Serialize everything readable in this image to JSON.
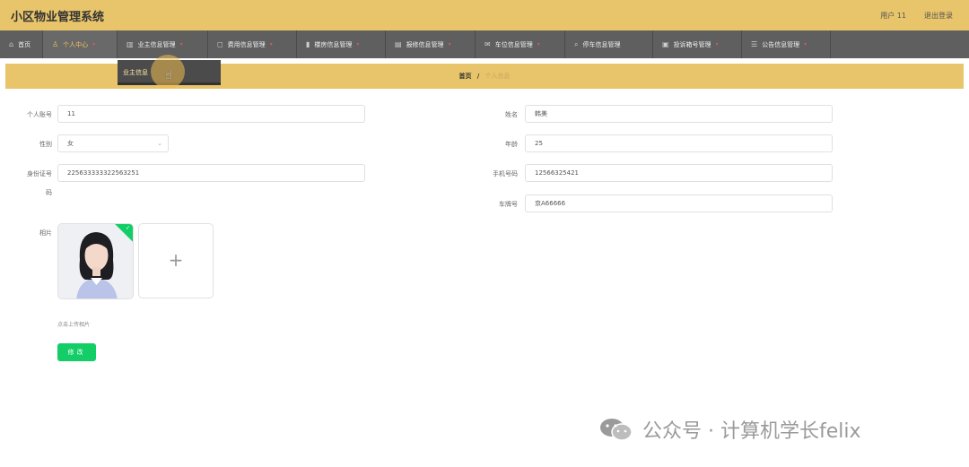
{
  "header": {
    "title": "小区物业管理系统",
    "user": "用户 11",
    "logout": "退出登录",
    "bg_color": "#e8c46a"
  },
  "nav": {
    "items": [
      {
        "label": "首页",
        "icon": "home-icon"
      },
      {
        "label": "个人中心",
        "icon": "user-icon",
        "active": true
      },
      {
        "label": "业主信息管理",
        "icon": "building-icon"
      },
      {
        "label": "费用信息管理",
        "icon": "square-icon"
      },
      {
        "label": "楼房信息管理",
        "icon": "bars-icon"
      },
      {
        "label": "报修信息管理",
        "icon": "message-icon"
      },
      {
        "label": "车位信息管理",
        "icon": "mail-icon"
      },
      {
        "label": "停车信息管理",
        "icon": "search-icon"
      },
      {
        "label": "投诉箱号管理",
        "icon": "inbox-icon"
      },
      {
        "label": "公告信息管理",
        "icon": "list-icon"
      }
    ],
    "dropdown_item": "业主信息"
  },
  "breadcrumb": {
    "home": "首页",
    "separator": "/",
    "current": "个人信息"
  },
  "form": {
    "account_label": "个人账号",
    "account_value": "11",
    "name_label": "姓名",
    "name_value": "韩美",
    "gender_label": "性别",
    "gender_value": "女",
    "age_label": "年龄",
    "age_value": "25",
    "id_label_line1": "身份证号",
    "id_label_line2": "码",
    "id_value": "225633333322563251",
    "phone_label": "手机号码",
    "phone_value": "12566325421",
    "plate_label": "车牌号",
    "plate_value": "京A66666",
    "photo_label": "相片",
    "upload_plus": "+",
    "upload_tip": "点击上传相片",
    "submit_label": "修改"
  },
  "watermark": {
    "text": "公众号 · 计算机学长felix"
  },
  "colors": {
    "accent": "#e8c46a",
    "nav_bg": "#5f5f5f",
    "success": "#13ce66"
  }
}
